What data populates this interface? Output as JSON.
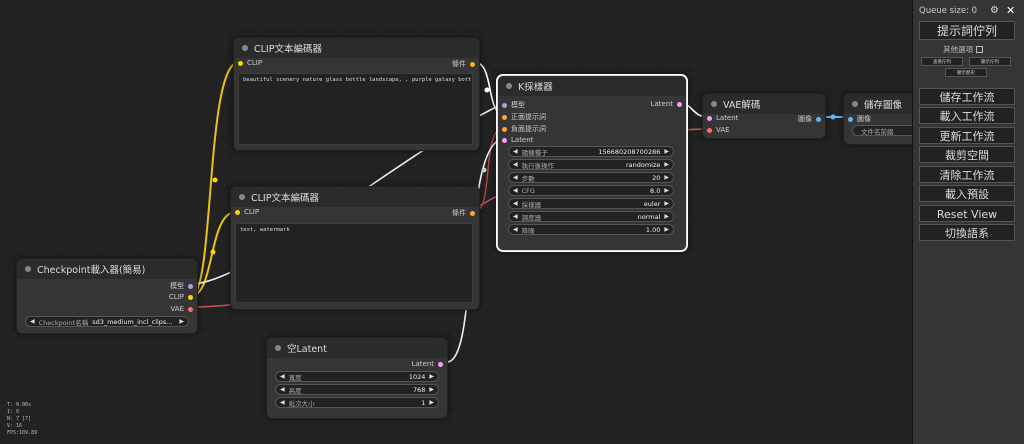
{
  "menu": {
    "queue_size": "Queue size: 0",
    "queue_prompt": "提示詞佇列",
    "extra_options": "其他選項",
    "small_buttons": [
      "查看佇列",
      "顯示佇列",
      "顯示歷史"
    ],
    "save": "儲存工作流",
    "load": "載入工作流",
    "refresh": "更新工作流",
    "clipspace": "裁剪空間",
    "clear": "清除工作流",
    "load_default": "載入預設",
    "reset_view": "Reset View",
    "switch_locale": "切換語系"
  },
  "nodes": {
    "clip_pos": {
      "title": "CLIP文本編碼器",
      "input_clip": "CLIP",
      "output": "條件",
      "text": "beautiful scenery nature glass bottle landscape, , purple galaxy bottle,"
    },
    "clip_neg": {
      "title": "CLIP文本編碼器",
      "input_clip": "CLIP",
      "output": "條件",
      "text": "text, watermark"
    },
    "checkpoint": {
      "title": "Checkpoint載入器(簡易)",
      "out_model": "模型",
      "out_clip": "CLIP",
      "out_vae": "VAE",
      "widget_label": "Checkpoint名稱",
      "widget_value": "sd3_medium_incl_clips..."
    },
    "ksampler": {
      "title": "K採樣器",
      "in_model": "模型",
      "in_positive": "正面提示詞",
      "in_negative": "負面提示詞",
      "in_latent": "Latent",
      "output": "Latent",
      "widgets": [
        {
          "label": "隨機種子",
          "value": "156680208700286"
        },
        {
          "label": "執行後操作",
          "value": "randomize"
        },
        {
          "label": "步數",
          "value": "20"
        },
        {
          "label": "CFG",
          "value": "8.0"
        },
        {
          "label": "採樣器",
          "value": "euler"
        },
        {
          "label": "調度器",
          "value": "normal"
        },
        {
          "label": "降噪",
          "value": "1.00"
        }
      ]
    },
    "vae_decode": {
      "title": "VAE解碼",
      "in_latent": "Latent",
      "in_vae": "VAE",
      "output": "圖像"
    },
    "save_image": {
      "title": "儲存圖像",
      "in_images": "圖像",
      "widget": "文件名前綴"
    },
    "empty_latent": {
      "title": "空Latent",
      "output": "Latent",
      "widgets": [
        {
          "label": "寬度",
          "value": "1024"
        },
        {
          "label": "高度",
          "value": "768"
        },
        {
          "label": "批次大小",
          "value": "1"
        }
      ]
    }
  },
  "stats": [
    "T: 0.00s",
    "I: 0",
    "N: 7 [7]",
    "V: 16",
    "FPS:109.89"
  ],
  "colors": {
    "clip": "#ffd500",
    "conditioning": "#ffa931",
    "latent": "#ff9cf9",
    "vae": "#ff6e6e",
    "image": "#64b5f6",
    "model": "#b39ddb"
  }
}
